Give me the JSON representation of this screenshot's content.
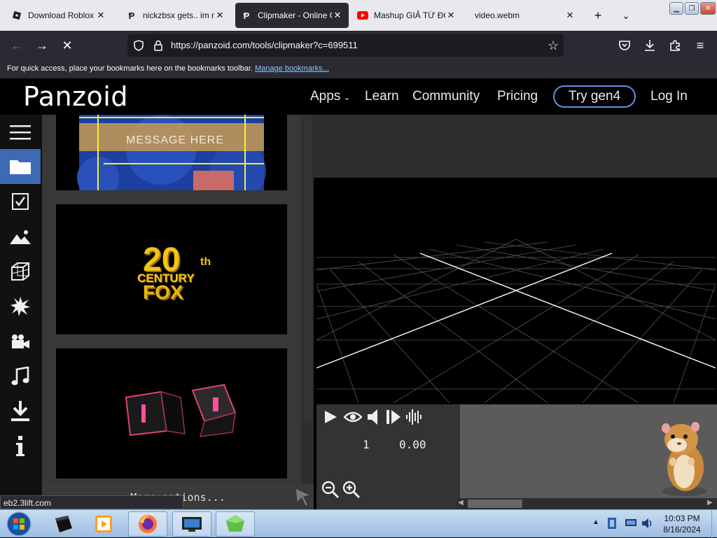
{
  "browser": {
    "tabs": [
      {
        "label": "Download Roblox",
        "icon": "roblox-icon"
      },
      {
        "label": "nickzbsx gets.. im nc",
        "icon": "panzoid-p-icon"
      },
      {
        "label": "Clipmaker - Online C",
        "icon": "panzoid-p-icon",
        "active": true
      },
      {
        "label": "Mashup GIẢ TỪ ĐOẠ",
        "icon": "youtube-icon"
      },
      {
        "label": "video.webm",
        "icon": ""
      }
    ],
    "new_tab": "+",
    "url": "https://panzoid.com/tools/clipmaker?c=699511",
    "bookmarks_msg": "For quick access, place your bookmarks here on the bookmarks toolbar.",
    "bookmarks_link": "Manage bookmarks..."
  },
  "site": {
    "logo": "Panzoid",
    "nav": {
      "apps": "Apps",
      "learn": "Learn",
      "community": "Community",
      "pricing": "Pricing",
      "try": "Try gen4",
      "login": "Log In"
    }
  },
  "templates": {
    "card1_text": "MESSAGE HERE",
    "card2_big": "20",
    "card2_th": "th",
    "card2_century": "CENTURY",
    "card2_fox": "FOX",
    "more_options": "More options..."
  },
  "player": {
    "frame": "1",
    "time": "0.00"
  },
  "status_link": "eb2.3lift.com",
  "clock": {
    "time": "10:03 PM",
    "date": "8/16/2024"
  },
  "colors": {
    "accent": "#3d6ab3",
    "gen4_border": "#5f8fe6",
    "youtube": "#ff0000"
  }
}
